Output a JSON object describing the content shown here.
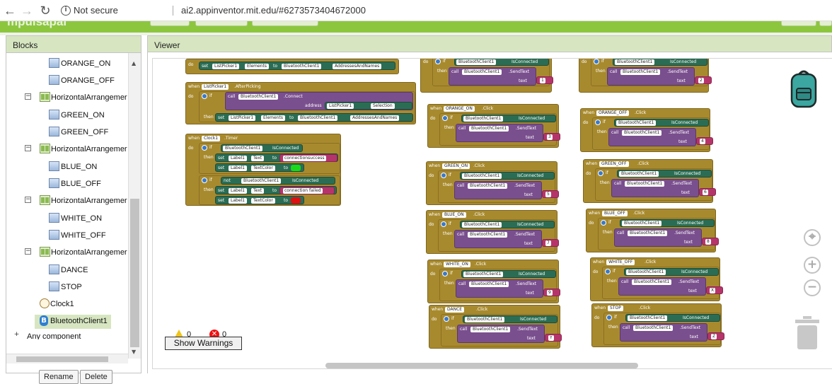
{
  "browser": {
    "not_secure": "Not secure",
    "url": "ai2.appinventor.mit.edu/#6273573404672000"
  },
  "app": {
    "title": "mpulsapal"
  },
  "blocks_panel": {
    "title": "Blocks",
    "items": [
      {
        "label": "ORANGE_ON",
        "kind": "image"
      },
      {
        "label": "ORANGE_OFF",
        "kind": "image"
      },
      {
        "label": "HorizontalArrangemer",
        "kind": "arrangement"
      },
      {
        "label": "GREEN_ON",
        "kind": "image"
      },
      {
        "label": "GREEN_OFF",
        "kind": "image"
      },
      {
        "label": "HorizontalArrangemer",
        "kind": "arrangement"
      },
      {
        "label": "BLUE_ON",
        "kind": "image"
      },
      {
        "label": "BLUE_OFF",
        "kind": "image"
      },
      {
        "label": "HorizontalArrangemer",
        "kind": "arrangement"
      },
      {
        "label": "WHITE_ON",
        "kind": "image"
      },
      {
        "label": "WHITE_OFF",
        "kind": "image"
      },
      {
        "label": "HorizontalArrangemer",
        "kind": "arrangement"
      },
      {
        "label": "DANCE",
        "kind": "image"
      },
      {
        "label": "STOP",
        "kind": "image"
      },
      {
        "label": "Clock1",
        "kind": "clock"
      },
      {
        "label": "BluetoothClient1",
        "kind": "bluetooth",
        "selected": true
      },
      {
        "label": "Any component",
        "kind": "any"
      }
    ],
    "rename_button": "Rename",
    "delete_button": "Delete"
  },
  "viewer": {
    "title": "Viewer",
    "warnings_count": "0",
    "errors_count": "0",
    "show_warnings_button": "Show Warnings"
  },
  "blocks": {
    "kw_do": "do",
    "kw_then": "then",
    "kw_when": "when",
    "kw_if": "if",
    "kw_set": "set",
    "kw_to": "to",
    "kw_call": "call",
    "kw_not": "not",
    "kw_address": "address",
    "kw_text": "text",
    "listpicker": "ListPicker1",
    "elements": "Elements",
    "bt": "BluetoothClient1",
    "addresses": "AddressesAndNames",
    "afterpicking": ".AfterPicking",
    "connect": ".Connect",
    "selection": "Selection",
    "clock": "Clock1",
    "timer": ".Timer",
    "is_connected": "IsConnected",
    "label": "Label1",
    "text_prop": "Text",
    "textcolor": "TextColor",
    "conn_success": "connectionsuccess",
    "conn_failed": "connection failed",
    "click": ".Click",
    "sendtext": ".SendText",
    "handlers": [
      {
        "button": "",
        "value": "1"
      },
      {
        "button": "",
        "value": "2"
      },
      {
        "button": "ORANGE_ON",
        "value": "3"
      },
      {
        "button": "ORANGE_OFF",
        "value": "4"
      },
      {
        "button": "GREEN_ON",
        "value": "5"
      },
      {
        "button": "GREEN_OFF",
        "value": "6"
      },
      {
        "button": "BLUE_ON",
        "value": "7"
      },
      {
        "button": "BLUE_OFF",
        "value": "8"
      },
      {
        "button": "WHITE_ON",
        "value": "9"
      },
      {
        "button": "WHITE_OFF",
        "value": "X"
      },
      {
        "button": "DANCE",
        "value": "Y"
      },
      {
        "button": "STOP",
        "value": "Z"
      }
    ]
  },
  "colors": {
    "header_green": "#8cc63f",
    "panel_head": "#d7e6c1",
    "event_block": "#a88a2e",
    "method_block": "#7a4f8e",
    "property_block": "#2b6d54",
    "text_block": "#b5356b"
  },
  "icons": [
    "back-arrow-icon",
    "forward-arrow-icon",
    "reload-icon",
    "info-icon",
    "backpack-icon",
    "center-icon",
    "zoom-in-icon",
    "zoom-out-icon",
    "trash-icon",
    "warning-icon",
    "error-icon"
  ]
}
